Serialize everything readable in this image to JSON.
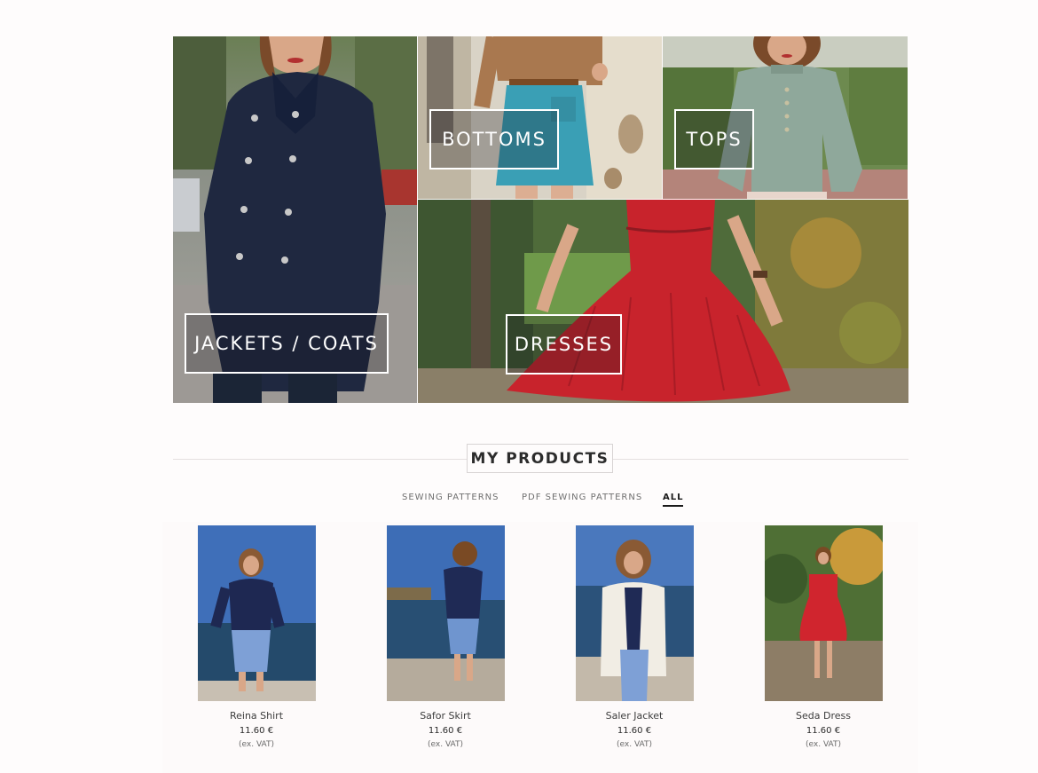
{
  "categories": {
    "jackets": {
      "label": "JACKETS / COATS"
    },
    "bottoms": {
      "label": "BOTTOMS"
    },
    "tops": {
      "label": "TOPS"
    },
    "dresses": {
      "label": "DRESSES"
    }
  },
  "products_section": {
    "title": "MY PRODUCTS",
    "tabs": [
      {
        "label": "SEWING PATTERNS",
        "active": false
      },
      {
        "label": "PDF SEWING PATTERNS",
        "active": false
      },
      {
        "label": "ALL",
        "active": true
      }
    ],
    "items": [
      {
        "name": "Reina Shirt",
        "price": "11.60 €",
        "vat_note": "(ex. VAT)"
      },
      {
        "name": "Safor Skirt",
        "price": "11.60 €",
        "vat_note": "(ex. VAT)"
      },
      {
        "name": "Saler Jacket",
        "price": "11.60 €",
        "vat_note": "(ex. VAT)"
      },
      {
        "name": "Seda Dress",
        "price": "11.60 €",
        "vat_note": "(ex. VAT)"
      }
    ]
  },
  "colors": {
    "background": "#fefcfc",
    "text_dark": "#2c2c2c",
    "coat_navy": "#1f2840",
    "skirt_teal": "#3a9fb5",
    "dress_red": "#c8232c"
  }
}
